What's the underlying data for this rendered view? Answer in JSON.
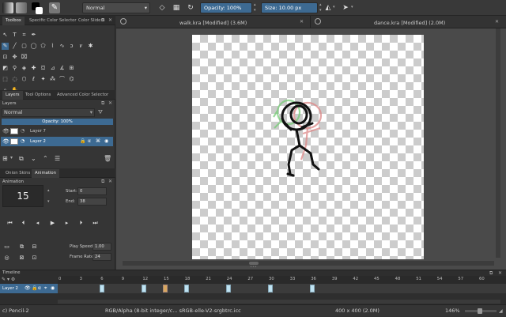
{
  "toolbar": {
    "blend_mode": "Normal",
    "opacity_label": "Opacity:",
    "opacity_value": "100%",
    "size_label": "Size:",
    "size_value": "10.00 px"
  },
  "docker_tabs_top": [
    "Toolbox",
    "Specific Color Selector",
    "Color Sliders"
  ],
  "docker_tabs_mid": [
    "Layers",
    "Tool Options",
    "Advanced Color Selector"
  ],
  "layers": {
    "title": "Layers",
    "blend_mode": "Normal",
    "opacity_label": "Opacity:",
    "opacity_value": "100%",
    "items": [
      {
        "name": "Layer 7",
        "selected": false
      },
      {
        "name": "Layer 2",
        "selected": true
      }
    ]
  },
  "docker_tabs_anim": [
    "Onion Skins",
    "Animation"
  ],
  "animation": {
    "title": "Animation",
    "current_frame": "15",
    "start_label": "Start:",
    "start_value": "0",
    "end_label": "End:",
    "end_value": "38",
    "play_speed_label": "Play Speed:",
    "play_speed_value": "1.00",
    "frame_rate_label": "Frame Rate:",
    "frame_rate_value": "24"
  },
  "documents": [
    {
      "title": "walk.kra [Modified]  (3.6M)"
    },
    {
      "title": "dance.kra [Modified]  (2.0M)"
    }
  ],
  "timeline": {
    "title": "Timeline",
    "layer_name": "Layer 2",
    "ticks": [
      "0",
      "3",
      "6",
      "9",
      "12",
      "15",
      "18",
      "21",
      "24",
      "27",
      "30",
      "33",
      "36",
      "39",
      "42",
      "45",
      "48",
      "51",
      "54",
      "57",
      "60"
    ],
    "keyframes": [
      6,
      12,
      18,
      24,
      30,
      36
    ],
    "current_frame": 15
  },
  "status": {
    "brush": "c) Pencil-2",
    "color_space": "RGB/Alpha (8-bit integer/c...  sRGB-elle-V2-srgbtrc.icc",
    "dimensions": "400 x 400 (2.0M)",
    "zoom": "146%"
  },
  "colors": {
    "accent": "#3d6a92",
    "keyframe": "#bfe3f2",
    "current_keyframe": "#d9a860"
  }
}
